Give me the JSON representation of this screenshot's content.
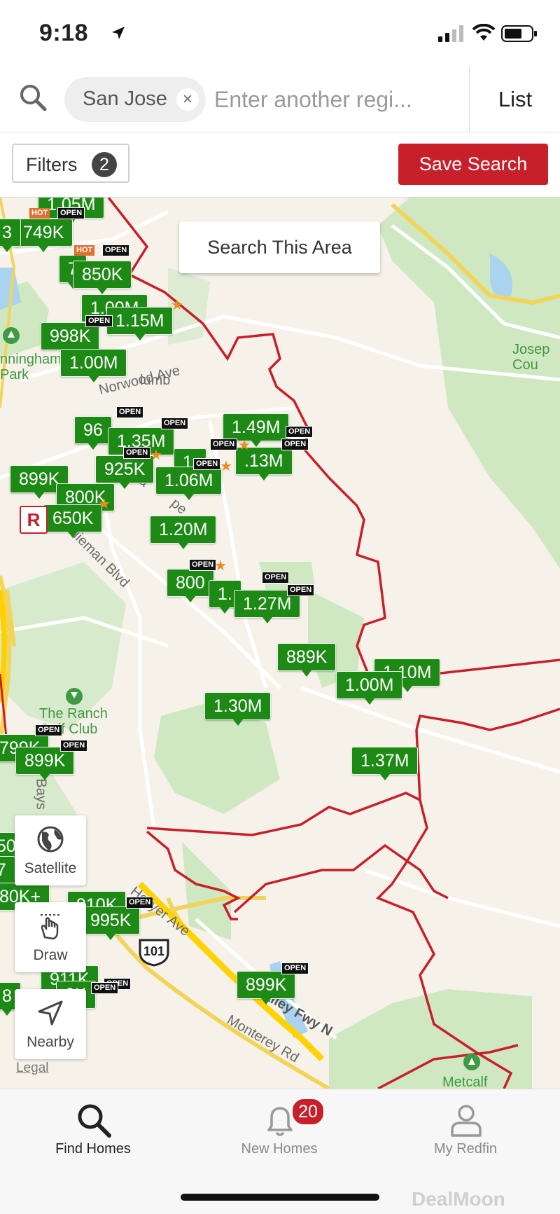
{
  "status_bar": {
    "time": "9:18"
  },
  "search": {
    "chip_label": "San Jose",
    "chip_close": "×",
    "placeholder": "Enter another regi...",
    "list_label": "List"
  },
  "filters": {
    "label": "Filters",
    "count": "2",
    "save_label": "Save Search"
  },
  "map": {
    "search_area_label": "Search This Area",
    "legal": "Legal",
    "street_labels": [
      "Norwood Ave",
      "Nieman Blvd",
      "Hellyer Ave",
      "S Valley Fwy N",
      "Monterey Rd",
      "Bays",
      "Sa",
      "lumb",
      "pe"
    ],
    "park_labels": [
      "nningham\nPark",
      "The Ranch\nGolf Club",
      "Josep\nCou",
      "Metcalf"
    ],
    "highway_shield": "101",
    "prices": [
      "1.05M",
      "749K",
      "3",
      "850K",
      "7",
      "1.00M",
      "1.15M",
      "998K",
      "1.00M",
      "96",
      "1.35M",
      "925K",
      "1.49M",
      "1.06M",
      "1.",
      "899K",
      "800K",
      "650K",
      ".13M",
      "1.20M",
      "800",
      "1.27M",
      "1.",
      "889K",
      "1.10M",
      "1.00M",
      "1.30M",
      "799K",
      "899K",
      "1.37M",
      "50",
      "7",
      "80K+",
      "910K",
      "995K",
      "899K",
      "911K",
      "0K",
      "8"
    ],
    "tags": {
      "open": "OPEN",
      "hot": "HOT"
    },
    "r_badge": "R",
    "tools": {
      "satellite": "Satellite",
      "draw": "Draw",
      "nearby": "Nearby"
    }
  },
  "tabs": [
    {
      "label": "Find Homes",
      "active": true
    },
    {
      "label": "New Homes",
      "badge": "20"
    },
    {
      "label": "My Redfin"
    }
  ],
  "watermark": "DealMoon",
  "colors": {
    "accent": "#c8202a",
    "price_pin": "#1e8a16",
    "boundary": "#c8202a",
    "park": "#cfe8c2"
  }
}
